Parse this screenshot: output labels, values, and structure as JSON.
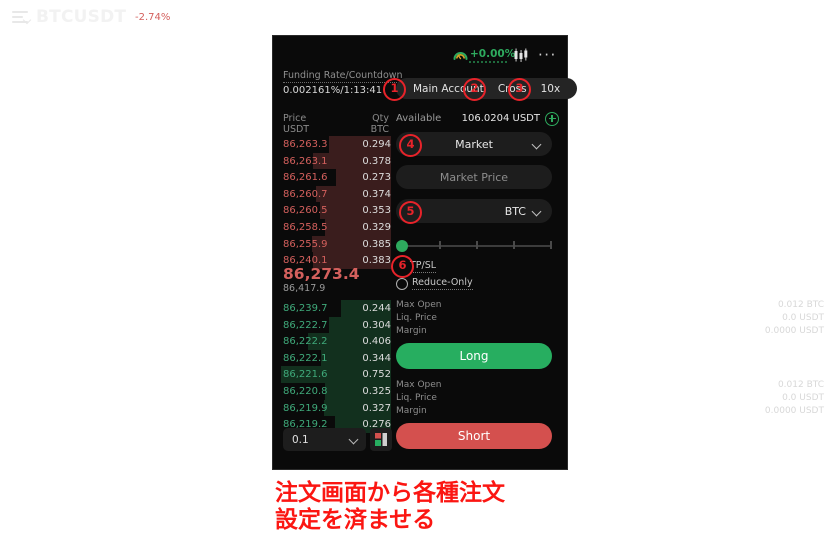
{
  "header": {
    "menu_icon": "hamburger-sort-icon",
    "symbol": "BTCUSDT",
    "symbol_change": "-2.74%",
    "gauge_icon": "gauge-icon",
    "gauge_value": "+0.00%",
    "chart_icon": "candlestick-chart-icon",
    "more_icon": "···"
  },
  "funding": {
    "label": "Funding Rate/Countdown",
    "value": "0.002161%/1:13:41"
  },
  "account_pills": {
    "account": "Main Account",
    "margin_mode": "Cross",
    "leverage": "10x"
  },
  "orderbook": {
    "header": {
      "price": "Price",
      "price_unit": "USDT",
      "qty": "Qty",
      "qty_unit": "BTC"
    },
    "asks": [
      {
        "price": "86,263.3",
        "qty": "0.294",
        "depth": 62
      },
      {
        "price": "86,263.1",
        "qty": "0.378",
        "depth": 78
      },
      {
        "price": "86,261.6",
        "qty": "0.273",
        "depth": 55
      },
      {
        "price": "86,260.7",
        "qty": "0.374",
        "depth": 75
      },
      {
        "price": "86,260.5",
        "qty": "0.353",
        "depth": 71
      },
      {
        "price": "86,258.5",
        "qty": "0.329",
        "depth": 66
      },
      {
        "price": "86,255.9",
        "qty": "0.385",
        "depth": 79
      },
      {
        "price": "86,240.1",
        "qty": "0.383",
        "depth": 78
      }
    ],
    "mid_price": "86,273.4",
    "mid_price_sub": "86,417.9",
    "bids": [
      {
        "price": "86,239.7",
        "qty": "0.244",
        "depth": 50
      },
      {
        "price": "86,222.7",
        "qty": "0.304",
        "depth": 62
      },
      {
        "price": "86,222.2",
        "qty": "0.406",
        "depth": 83
      },
      {
        "price": "86,222.1",
        "qty": "0.344",
        "depth": 70
      },
      {
        "price": "86,221.6",
        "qty": "0.752",
        "depth": 110
      },
      {
        "price": "86,220.8",
        "qty": "0.325",
        "depth": 66
      },
      {
        "price": "86,219.9",
        "qty": "0.327",
        "depth": 67
      },
      {
        "price": "86,219.2",
        "qty": "0.276",
        "depth": 56
      }
    ],
    "tick_size": "0.1",
    "depth_view_icon": "depth-view-toggle-icon"
  },
  "order_panel": {
    "available_label": "Available",
    "available_value": "106.0204 USDT",
    "deposit_icon": "plus-circle-icon",
    "order_type": "Market",
    "price_placeholder": "Market Price",
    "qty_unit": "BTC",
    "slider_value": 0,
    "tpsl_label": "TP/SL",
    "reduce_only_label": "Reduce-Only",
    "long_stats": [
      {
        "label": "Max Open",
        "value": "0.012 BTC"
      },
      {
        "label": "Liq. Price",
        "value": "0.0 USDT"
      },
      {
        "label": "Margin",
        "value": "0.0000 USDT"
      }
    ],
    "long_button": "Long",
    "short_stats": [
      {
        "label": "Max Open",
        "value": "0.012 BTC"
      },
      {
        "label": "Liq. Price",
        "value": "0.0 USDT"
      },
      {
        "label": "Margin",
        "value": "0.0000 USDT"
      }
    ],
    "short_button": "Short"
  },
  "callouts": [
    {
      "n": "①",
      "label": "1"
    },
    {
      "n": "②",
      "label": "2"
    },
    {
      "n": "③",
      "label": "3"
    },
    {
      "n": "④",
      "label": "4"
    },
    {
      "n": "⑤",
      "label": "5"
    },
    {
      "n": "⑥",
      "label": "6"
    }
  ],
  "caption": {
    "line1": "注文画面から各種注文",
    "line2": "設定を済ませる"
  },
  "colors": {
    "long_green": "#27ae60",
    "short_red": "#d4504e",
    "ask_red": "#d4605d",
    "bid_green": "#3fa97a",
    "callout_red": "#e8232a",
    "caption_red": "#fb1612"
  }
}
